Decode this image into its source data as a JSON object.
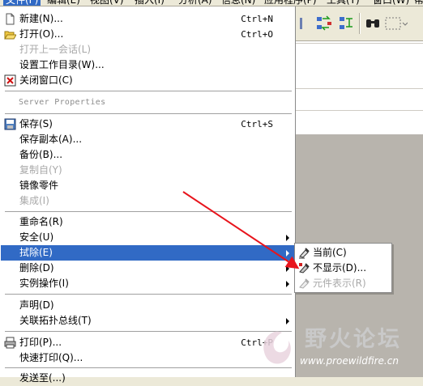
{
  "menubar": {
    "items": [
      {
        "label": "文件(F)",
        "active": true
      },
      {
        "label": "编辑(E)"
      },
      {
        "label": "视图(V)"
      },
      {
        "label": "插入(I)"
      },
      {
        "label": "分析(A)"
      },
      {
        "label": "信息(N)"
      },
      {
        "label": "应用程序(P)"
      },
      {
        "label": "工具(T)"
      },
      {
        "label": "窗口(W)"
      },
      {
        "label": "帮"
      }
    ]
  },
  "file_menu": {
    "items": [
      {
        "label": "新建(N)...",
        "shortcut": "Ctrl+N",
        "icon": "new-file-icon"
      },
      {
        "label": "打开(O)...",
        "shortcut": "Ctrl+O",
        "icon": "open-folder-icon"
      },
      {
        "label": "打开上一会话(L)",
        "disabled": true
      },
      {
        "label": "设置工作目录(W)..."
      },
      {
        "label": "关闭窗口(C)",
        "icon": "close-window-icon"
      },
      {
        "label": "保存(S)",
        "shortcut": "Ctrl+S",
        "icon": "save-disk-icon"
      },
      {
        "label": "保存副本(A)..."
      },
      {
        "label": "备份(B)..."
      },
      {
        "label": "复制自(Y)",
        "disabled": true
      },
      {
        "label": "镜像零件"
      },
      {
        "label": "集成(I)",
        "disabled": true
      },
      {
        "label": "重命名(R)"
      },
      {
        "label": "安全(U)",
        "submenu": true
      },
      {
        "label": "拭除(E)",
        "submenu": true,
        "highlighted": true
      },
      {
        "label": "删除(D)",
        "submenu": true
      },
      {
        "label": "实例操作(I)",
        "submenu": true
      },
      {
        "label": "声明(D)"
      },
      {
        "label": "关联拓扑总线(T)",
        "submenu": true
      },
      {
        "label": "打印(P)...",
        "shortcut": "Ctrl+P",
        "icon": "printer-icon"
      },
      {
        "label": "快速打印(Q)..."
      },
      {
        "label": "发送至(...)"
      }
    ],
    "section_heading": "Server Properties"
  },
  "erase_submenu": {
    "items": [
      {
        "label": "当前(C)",
        "icon": "erase-current-icon"
      },
      {
        "label": "不显示(D)...",
        "icon": "erase-not-displayed-icon"
      },
      {
        "label": "元件表示(R)",
        "disabled": true,
        "icon": "component-representation-icon"
      }
    ]
  },
  "watermark": {
    "title": "野火论坛",
    "url": "www.proewildfire.cn"
  },
  "colors": {
    "highlight": "#316ac5",
    "annotation_arrow": "#e8141c",
    "disabled_text": "#a9a9a9"
  }
}
